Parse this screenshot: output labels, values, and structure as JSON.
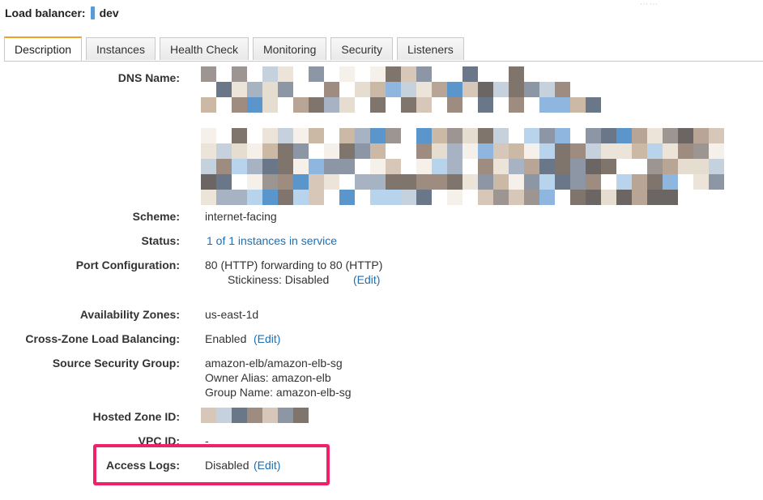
{
  "header": {
    "label": "Load balancer:",
    "name": "dev"
  },
  "tabs": [
    {
      "label": "Description"
    },
    {
      "label": "Instances"
    },
    {
      "label": "Health Check"
    },
    {
      "label": "Monitoring"
    },
    {
      "label": "Security"
    },
    {
      "label": "Listeners"
    }
  ],
  "fields": {
    "dns_name": {
      "label": "DNS Name:"
    },
    "scheme": {
      "label": "Scheme:",
      "value": "internet-facing"
    },
    "status": {
      "label": "Status:",
      "value": "1 of 1 instances in service"
    },
    "port_configuration": {
      "label": "Port Configuration:",
      "value": "80 (HTTP) forwarding to 80 (HTTP)",
      "stickiness": "Stickiness: Disabled",
      "edit": "(Edit)"
    },
    "availability_zones": {
      "label": "Availability Zones:",
      "value": "us-east-1d"
    },
    "cross_zone": {
      "label": "Cross-Zone Load Balancing:",
      "value": "Enabled",
      "edit": "(Edit)"
    },
    "source_security_group": {
      "label": "Source Security Group:",
      "value": "amazon-elb/amazon-elb-sg",
      "owner_alias": "Owner Alias: amazon-elb",
      "group_name": "Group Name: amazon-elb-sg"
    },
    "hosted_zone_id": {
      "label": "Hosted Zone ID:"
    },
    "vpc_id": {
      "label": "VPC ID:",
      "value": "-"
    },
    "access_logs": {
      "label": "Access Logs:",
      "value": "Disabled",
      "edit": "(Edit)"
    }
  },
  "colors": {
    "link": "#1a6fb5",
    "active_tab_accent": "#f0a028",
    "highlight_border": "#f0206a",
    "header_bar": "#5b9bd5"
  }
}
